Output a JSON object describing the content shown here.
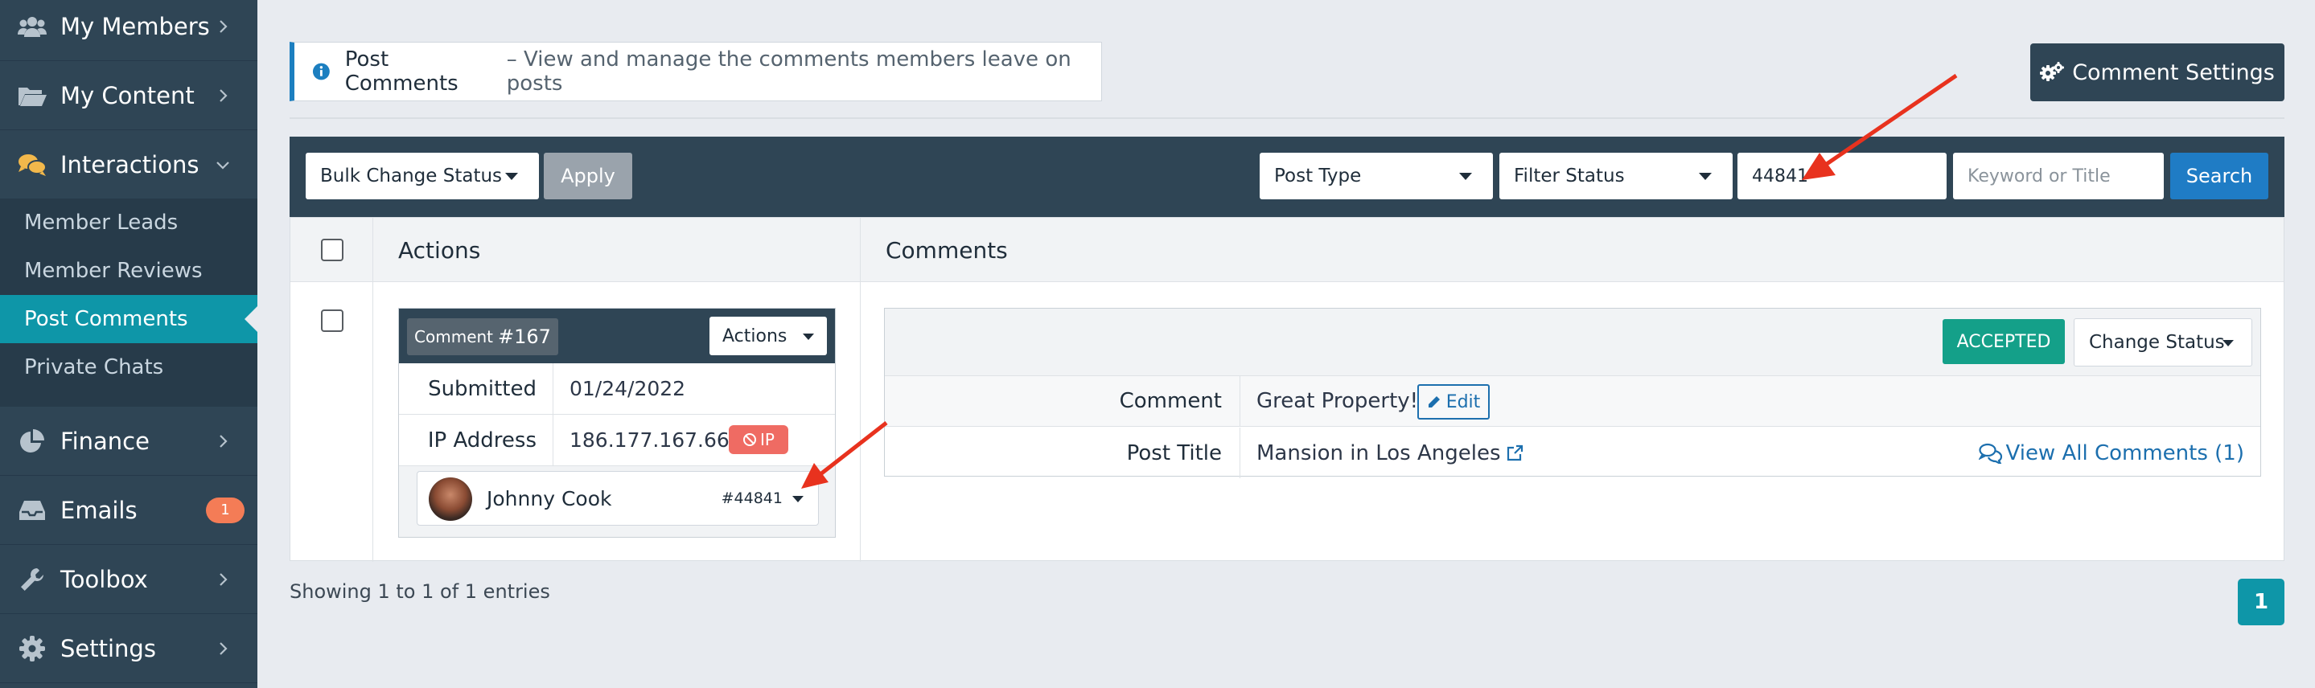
{
  "sidebar": {
    "items": [
      {
        "label": "My Members",
        "icon": "users-icon"
      },
      {
        "label": "My Content",
        "icon": "folder-open-icon"
      },
      {
        "label": "Interactions",
        "icon": "comments-icon"
      },
      {
        "label": "Finance",
        "icon": "pie-chart-icon"
      },
      {
        "label": "Emails",
        "icon": "inbox-icon",
        "badge": "1"
      },
      {
        "label": "Toolbox",
        "icon": "wrench-icon"
      },
      {
        "label": "Settings",
        "icon": "gear-icon"
      }
    ],
    "subitems": [
      {
        "label": "Member Leads"
      },
      {
        "label": "Member Reviews"
      },
      {
        "label": "Post Comments",
        "active": true
      },
      {
        "label": "Private Chats"
      }
    ]
  },
  "header": {
    "title": "Post Comments",
    "description": "– View and manage the comments members leave on posts",
    "settings_button": "Comment Settings"
  },
  "filters": {
    "bulk_action": "Bulk Change Status",
    "apply": "Apply",
    "post_type": "Post Type",
    "filter_status": "Filter Status",
    "member_id": "44841",
    "keyword_placeholder": "Keyword or Title",
    "search": "Search"
  },
  "table": {
    "col_actions": "Actions",
    "col_comments": "Comments"
  },
  "comment": {
    "label": "Comment",
    "number": "#167",
    "actions_button": "Actions",
    "submitted_label": "Submitted",
    "submitted": "01/24/2022",
    "ip_label": "IP Address",
    "ip": "186.177.167.66",
    "ip_badge": "IP",
    "member_name": "Johnny Cook",
    "member_id": "#44841",
    "status": "ACCEPTED",
    "change_status": "Change Status",
    "comment_label": "Comment",
    "comment_text": "Great Property!",
    "edit": "Edit",
    "post_title_label": "Post Title",
    "post_title": "Mansion in Los Angeles",
    "view_all": "View All Comments (1)"
  },
  "footer": {
    "showing": "Showing 1 to 1 of 1 entries",
    "page": "1"
  },
  "colors": {
    "sidebar": "#2f4555",
    "active": "#0e96a8",
    "accepted": "#14a089",
    "link": "#1c6fae",
    "arrow": "#e8321e"
  }
}
